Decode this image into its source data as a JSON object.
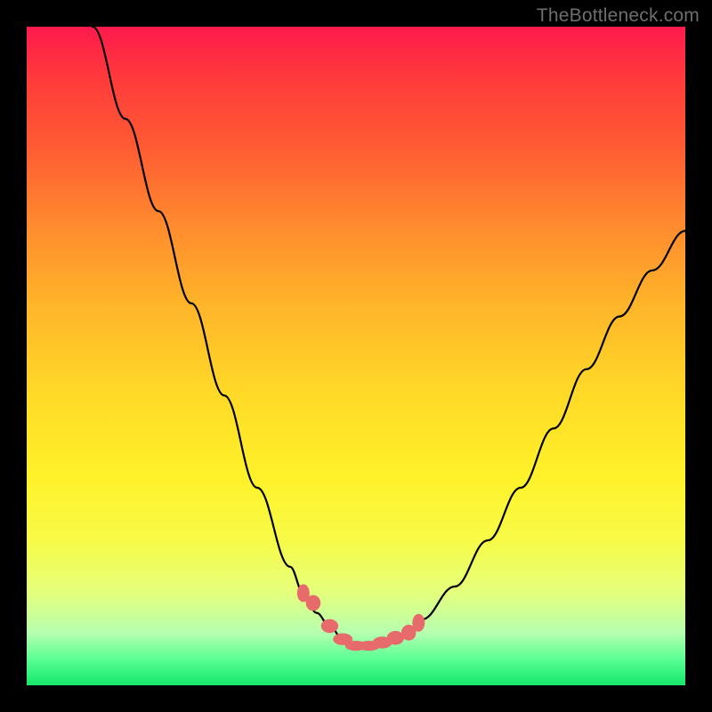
{
  "watermark": "TheBottleneck.com",
  "colors": {
    "frame": "#000000",
    "gradient_top": "#ff1a4d",
    "gradient_bottom": "#14e86b",
    "curve": "#000000",
    "marker": "#e86b6b",
    "watermark_text": "#6e6e6e"
  },
  "chart_data": {
    "type": "line",
    "title": "",
    "xlabel": "",
    "ylabel": "",
    "xlim": [
      0,
      100
    ],
    "ylim": [
      0,
      100
    ],
    "grid": false,
    "legend": false,
    "series": [
      {
        "name": "bottleneck-curve",
        "x": [
          10,
          15,
          20,
          25,
          30,
          35,
          40,
          42,
          44,
          46,
          48,
          50,
          52,
          54,
          56,
          58,
          60,
          65,
          70,
          75,
          80,
          85,
          90,
          95,
          100
        ],
        "values": [
          100,
          86,
          72,
          58,
          44,
          30,
          18,
          14,
          11,
          9,
          7,
          6,
          6,
          6,
          7,
          8,
          10,
          15,
          22,
          30,
          39,
          48,
          56,
          63,
          69
        ]
      }
    ],
    "markers": {
      "name": "flat-region-markers",
      "x": [
        42,
        43.5,
        46,
        48,
        50,
        52,
        54,
        56,
        58,
        59.5
      ],
      "values": [
        14,
        12.5,
        9,
        7,
        6,
        6,
        6.5,
        7.2,
        8,
        9.5
      ]
    }
  }
}
